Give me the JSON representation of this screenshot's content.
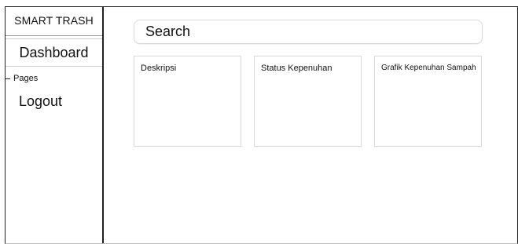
{
  "sidebar": {
    "brand": "SMART TRASH",
    "items": [
      {
        "label": "Dashboard"
      },
      {
        "label": "Pages"
      },
      {
        "label": "Logout"
      }
    ]
  },
  "search": {
    "placeholder": "Search"
  },
  "cards": [
    {
      "title": "Deskripsi"
    },
    {
      "title": "Status Kepenuhan"
    },
    {
      "title": "Grafik Kepenuhan Sampah"
    }
  ]
}
